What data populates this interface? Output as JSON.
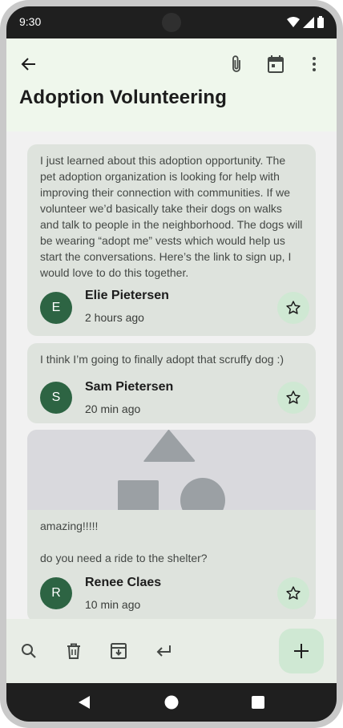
{
  "status_bar": {
    "time": "9:30"
  },
  "top_bar": {
    "title": "Adoption Volunteering"
  },
  "icons": {
    "back": "arrow-back-icon",
    "attach": "paperclip-icon",
    "calendar": "calendar-icon",
    "more": "more-vert-icon",
    "star": "star-outline-icon",
    "search": "search-icon",
    "delete": "trash-icon",
    "archive": "archive-icon",
    "reply": "reply-icon",
    "add": "plus-icon"
  },
  "messages": [
    {
      "body": "I just learned about this adoption opportunity. The pet adoption organization is looking for help with improving their connection with communities. If we volunteer we’d basically take their dogs on walks and talk to people in the neighborhood. The dogs will be wearing “adopt me” vests which would help us start the conversations. Here’s the link to sign up, I would love to do this together.",
      "avatar_initial": "E",
      "author": "Elie Pietersen",
      "time": "2 hours ago"
    },
    {
      "body": "I think I’m going to finally adopt that scruffy dog :)",
      "avatar_initial": "S",
      "author": "Sam Pietersen",
      "time": "20 min ago"
    },
    {
      "body_line1": "amazing!!!!!",
      "body_line2": "do you need a ride to the shelter?",
      "avatar_initial": "R",
      "author": "Renee Claes",
      "time": "10 min ago"
    }
  ],
  "colors": {
    "top_bar_bg": "#eff7ec",
    "card_bg": "#dee3dd",
    "avatar_bg": "#2d6443",
    "accent_container": "#cfe8d3",
    "bottom_bar_bg": "#e8ede6"
  }
}
